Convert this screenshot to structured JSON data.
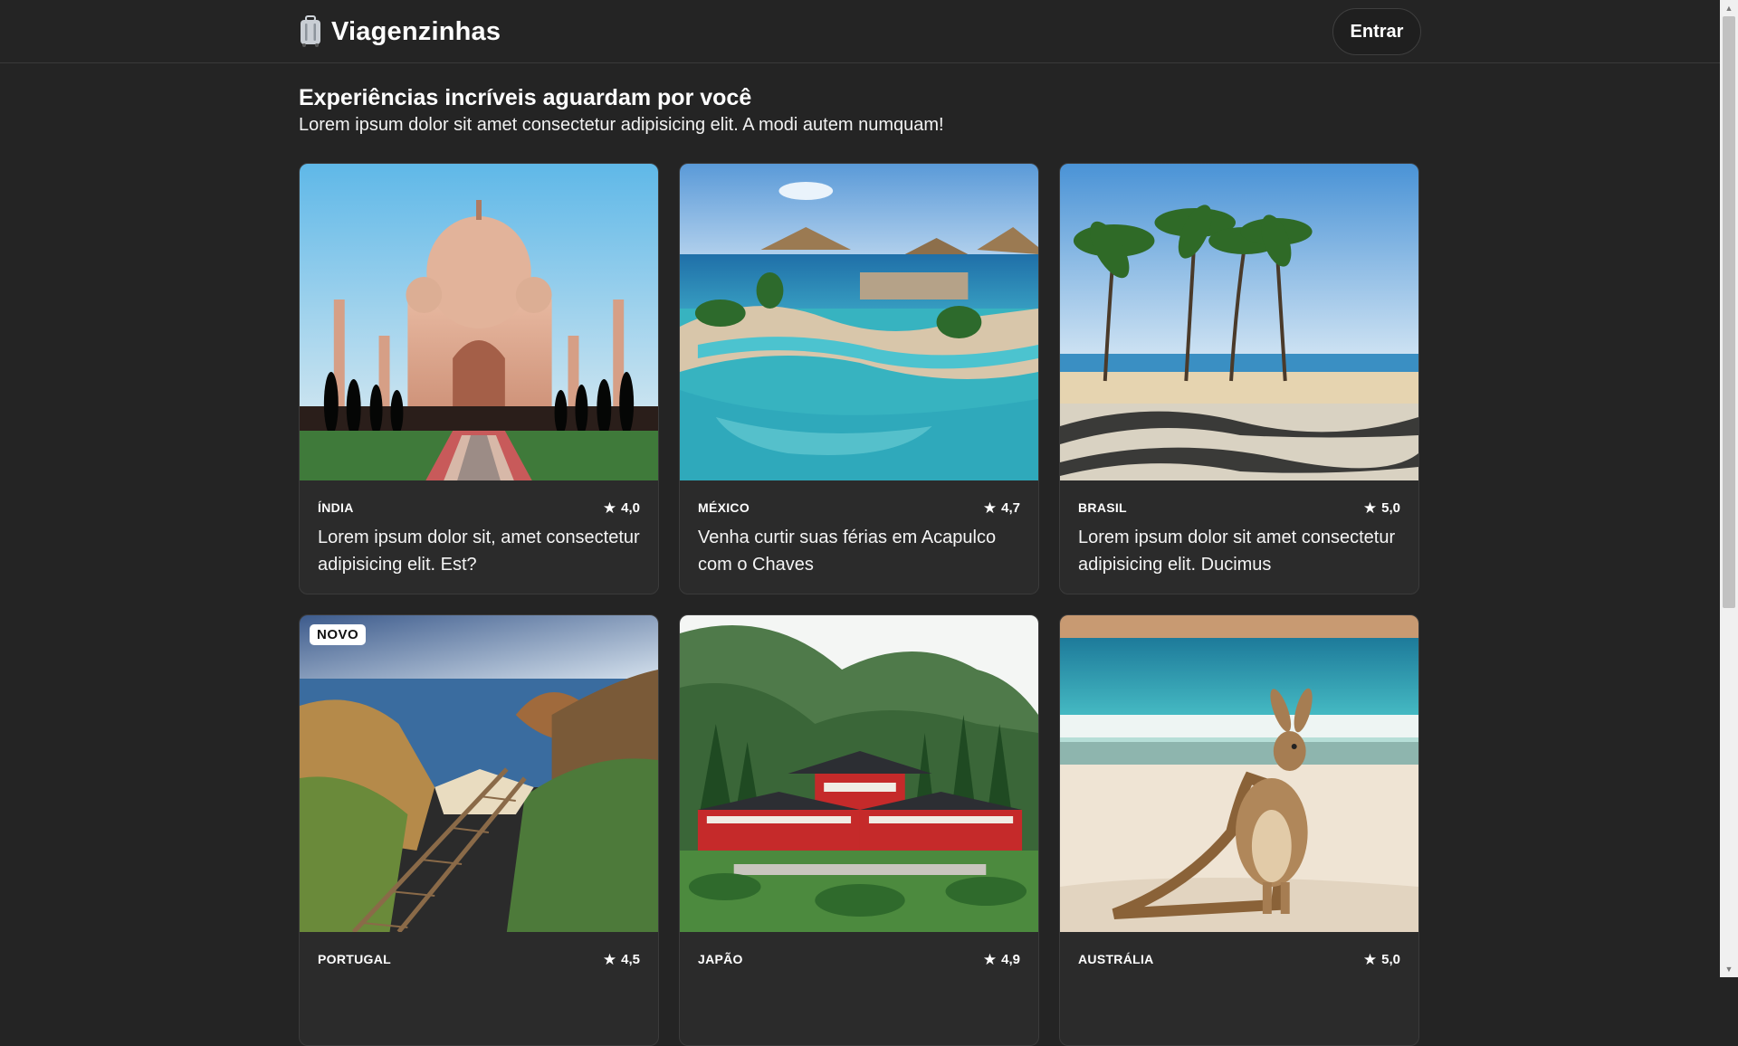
{
  "header": {
    "brand_name": "Viagenzinhas",
    "brand_icon": "suitcase-icon",
    "login_label": "Entrar"
  },
  "intro": {
    "title": "Experiências incríveis aguardam por você",
    "subtitle": "Lorem ipsum dolor sit amet consectetur adipisicing elit. A modi autem numquam!"
  },
  "destinations": [
    {
      "country": "Índia",
      "rating": "4,0",
      "badge": "",
      "description": "Lorem ipsum dolor sit, amet consectetur adipisicing elit. Est?",
      "image": "taj-mahal-image"
    },
    {
      "country": "México",
      "rating": "4,7",
      "badge": "",
      "description": "Venha curtir suas férias em Acapulco com o Chaves",
      "image": "acapulco-pool-image"
    },
    {
      "country": "Brasil",
      "rating": "5,0",
      "badge": "",
      "description": "Lorem ipsum dolor sit amet consectetur adipisicing elit. Ducimus",
      "image": "copacabana-beach-image"
    },
    {
      "country": "Portugal",
      "rating": "4,5",
      "badge": "NOVO",
      "description": "",
      "image": "algarve-coast-image"
    },
    {
      "country": "Japão",
      "rating": "4,9",
      "badge": "",
      "description": "",
      "image": "japanese-temple-image"
    },
    {
      "country": "Austrália",
      "rating": "5,0",
      "badge": "",
      "description": "",
      "image": "kangaroo-beach-image"
    }
  ],
  "colors": {
    "background": "#242424",
    "card": "#2b2b2b",
    "text": "#ffffff"
  }
}
